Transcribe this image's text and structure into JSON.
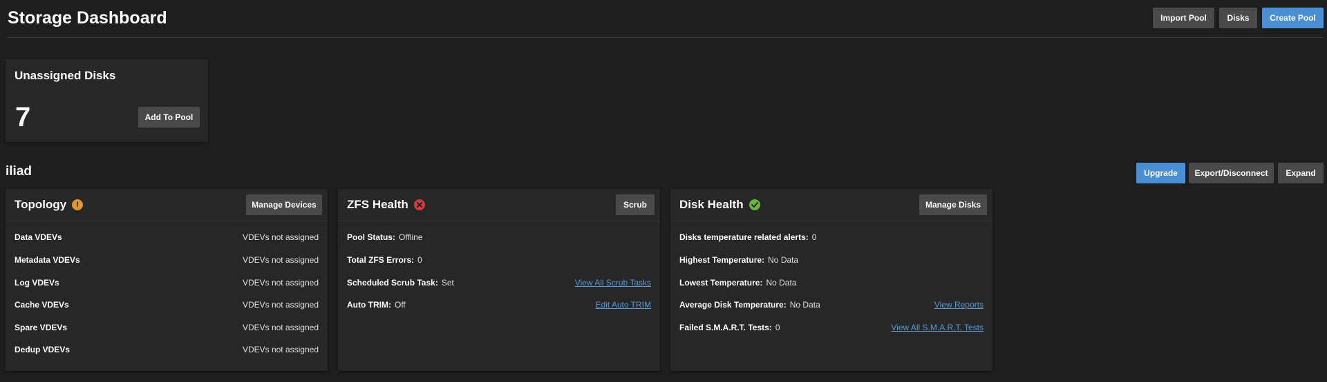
{
  "header": {
    "title": "Storage Dashboard",
    "buttons": {
      "import_pool": "Import Pool",
      "disks": "Disks",
      "create_pool": "Create Pool"
    }
  },
  "unassigned": {
    "title": "Unassigned Disks",
    "count": "7",
    "add_button": "Add To Pool"
  },
  "pool": {
    "name": "iliad",
    "buttons": {
      "upgrade": "Upgrade",
      "export": "Export/Disconnect",
      "expand": "Expand"
    }
  },
  "topology": {
    "title": "Topology",
    "status": "warning",
    "button": "Manage Devices",
    "rows": [
      {
        "label": "Data VDEVs",
        "value": "VDEVs not assigned"
      },
      {
        "label": "Metadata VDEVs",
        "value": "VDEVs not assigned"
      },
      {
        "label": "Log VDEVs",
        "value": "VDEVs not assigned"
      },
      {
        "label": "Cache VDEVs",
        "value": "VDEVs not assigned"
      },
      {
        "label": "Spare VDEVs",
        "value": "VDEVs not assigned"
      },
      {
        "label": "Dedup VDEVs",
        "value": "VDEVs not assigned"
      }
    ]
  },
  "zfs_health": {
    "title": "ZFS Health",
    "status": "error",
    "button": "Scrub",
    "rows": [
      {
        "label": "Pool Status:",
        "value": "Offline",
        "link": ""
      },
      {
        "label": "Total ZFS Errors:",
        "value": "0",
        "link": ""
      },
      {
        "label": "Scheduled Scrub Task:",
        "value": "Set",
        "link": "View All Scrub Tasks"
      },
      {
        "label": "Auto TRIM:",
        "value": "Off",
        "link": "Edit Auto TRIM"
      }
    ]
  },
  "disk_health": {
    "title": "Disk Health",
    "status": "ok",
    "button": "Manage Disks",
    "rows": [
      {
        "label": "Disks temperature related alerts:",
        "value": "0",
        "link": ""
      },
      {
        "label": "Highest Temperature:",
        "value": "No Data",
        "link": ""
      },
      {
        "label": "Lowest Temperature:",
        "value": "No Data",
        "link": ""
      },
      {
        "label": "Average Disk Temperature:",
        "value": "No Data",
        "link": "View Reports"
      },
      {
        "label": "Failed S.M.A.R.T. Tests:",
        "value": "0",
        "link": "View All S.M.A.R.T. Tests"
      }
    ]
  },
  "colors": {
    "background": "#1e1e1e",
    "card": "#272727",
    "primary": "#4a8fd4",
    "warning": "#e0952f",
    "error": "#d23b3b",
    "ok": "#6cb33f",
    "link": "#5a9ad6"
  }
}
